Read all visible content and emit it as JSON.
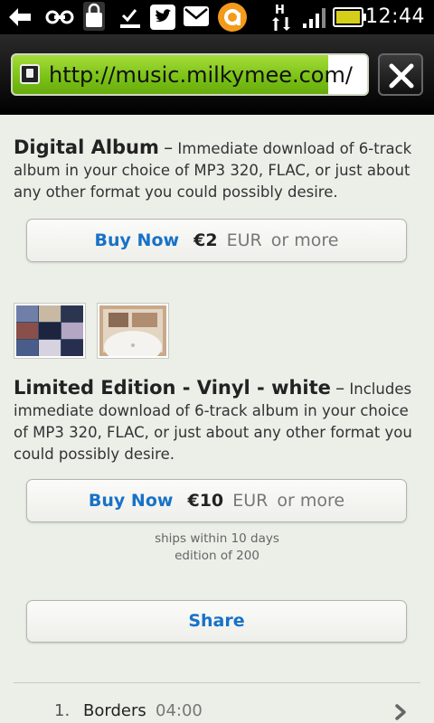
{
  "status_bar": {
    "time": "12:44",
    "network_type": "H",
    "icons": [
      "usb-debug-icon",
      "link-icon",
      "shopping-bag-icon",
      "download-done-icon",
      "twitter-icon",
      "mail-icon",
      "app-notification-icon",
      "network-arrows-icon",
      "signal-icon",
      "battery-icon"
    ]
  },
  "browser": {
    "url": "http://music.milkymee.com/",
    "load_progress": 0.89
  },
  "digital_album": {
    "title": "Digital Album",
    "separator": "–",
    "description": "Immediate download of 6-track album in your choice of MP3 320, FLAC, or just about any other format you could possibly desire.",
    "buy_label": "Buy Now",
    "price": "€2",
    "currency": "EUR",
    "or_more": "or more"
  },
  "vinyl": {
    "title": "Limited Edition - Vinyl - white",
    "separator": "–",
    "description": "Includes immediate download of 6-track album in your choice of MP3 320, FLAC, or just about any other format you could possibly desire.",
    "buy_label": "Buy Now",
    "price": "€10",
    "currency": "EUR",
    "or_more": "or more",
    "ships_note": "ships within 10 days",
    "edition_note": "edition of 200"
  },
  "share": {
    "label": "Share"
  },
  "tracklist": [
    {
      "number": "1.",
      "title": "Borders",
      "duration": "04:00"
    }
  ],
  "colors": {
    "link_blue": "#1772c7",
    "progress_green": "#7cc318",
    "page_background": "#eceee8"
  }
}
